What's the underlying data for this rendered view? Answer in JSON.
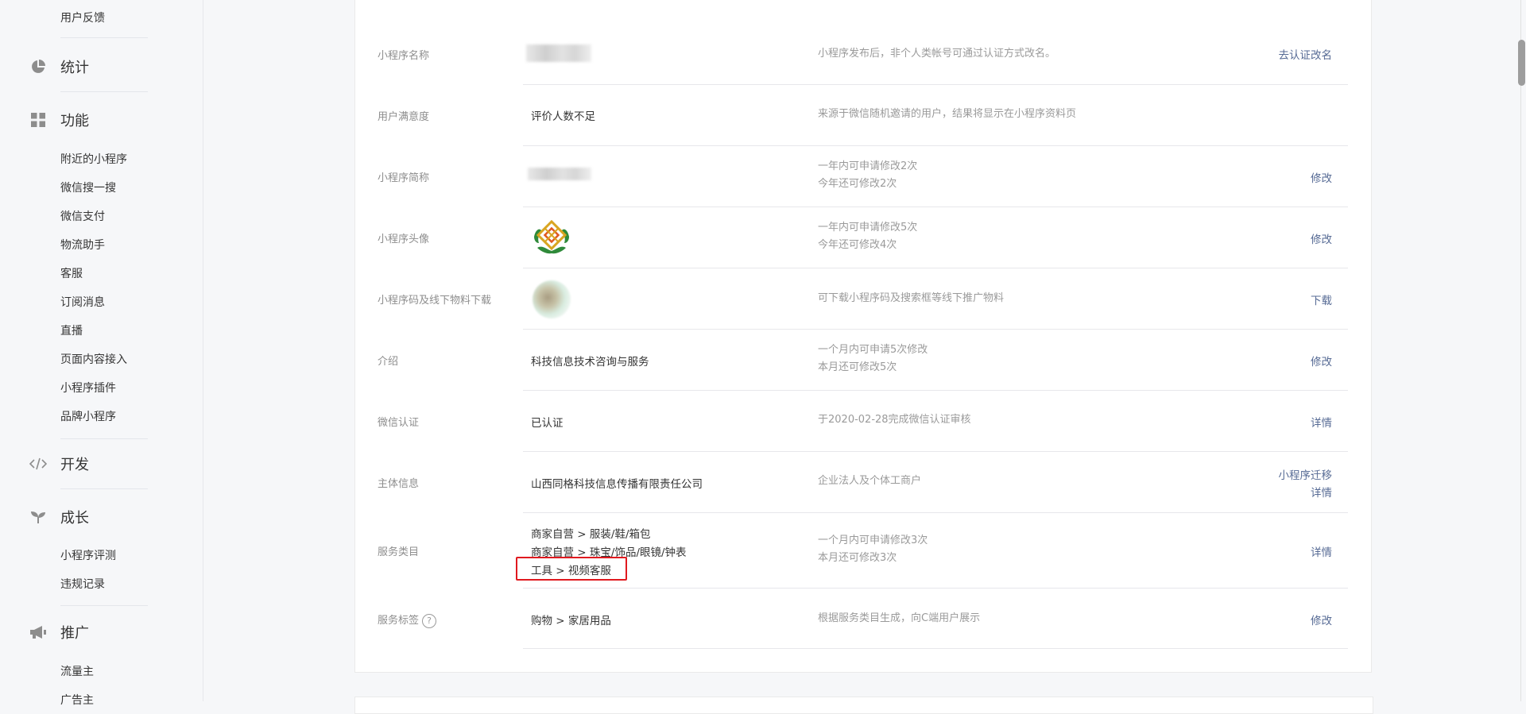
{
  "sidebar": {
    "top_item": "用户反馈",
    "groups": {
      "stats": "统计",
      "features": "功能",
      "dev": "开发",
      "growth": "成长",
      "promo": "推广"
    },
    "feature_items": [
      "附近的小程序",
      "微信搜一搜",
      "微信支付",
      "物流助手",
      "客服",
      "订阅消息",
      "直播",
      "页面内容接入",
      "小程序插件",
      "品牌小程序"
    ],
    "growth_items": [
      "小程序评测",
      "违规记录"
    ],
    "promo_items": [
      "流量主",
      "广告主"
    ]
  },
  "settings": {
    "rows": {
      "name": {
        "label": "小程序名称",
        "desc": "小程序发布后，非个人类帐号可通过认证方式改名。",
        "action": "去认证改名"
      },
      "satisfaction": {
        "label": "用户满意度",
        "value": "评价人数不足",
        "desc": "来源于微信随机邀请的用户，结果将显示在小程序资料页"
      },
      "short_name": {
        "label": "小程序简称",
        "desc1": "一年内可申请修改2次",
        "desc2": "今年还可修改2次",
        "action": "修改"
      },
      "avatar": {
        "label": "小程序头像",
        "desc1": "一年内可申请修改5次",
        "desc2": "今年还可修改4次",
        "action": "修改"
      },
      "qrcode": {
        "label": "小程序码及线下物料下载",
        "desc": "可下载小程序码及搜索框等线下推广物料",
        "action": "下载"
      },
      "intro": {
        "label": "介绍",
        "value": "科技信息技术咨询与服务",
        "desc1": "一个月内可申请5次修改",
        "desc2": "本月还可修改5次",
        "action": "修改"
      },
      "wechat_cert": {
        "label": "微信认证",
        "value": "已认证",
        "desc": "于2020-02-28完成微信认证审核",
        "action": "详情"
      },
      "entity": {
        "label": "主体信息",
        "value": "山西同格科技信息传播有限责任公司",
        "desc": "企业法人及个体工商户",
        "action1": "小程序迁移",
        "action2": "详情"
      },
      "category": {
        "label": "服务类目",
        "values": [
          "商家自营 > 服装/鞋/箱包",
          "商家自营 > 珠宝/饰品/眼镜/钟表",
          "工具 > 视频客服"
        ],
        "desc1": "一个月内可申请修改3次",
        "desc2": "本月还可修改3次",
        "action": "详情"
      },
      "tags": {
        "label": "服务标签",
        "help": "?",
        "value": "购物 > 家居用品",
        "desc": "根据服务类目生成，向C端用户展示",
        "action": "修改"
      }
    }
  },
  "colors": {
    "link": "#576b95",
    "highlight": "#e0191f"
  }
}
